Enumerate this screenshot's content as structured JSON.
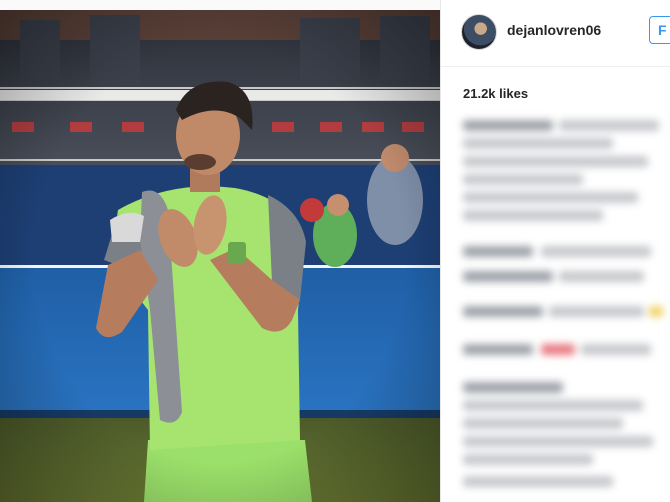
{
  "post": {
    "username": "dejanlovren06",
    "follow_label": "F",
    "likes": "21.2k likes"
  },
  "colors": {
    "accent": "#3897f0",
    "jersey": "#9be06a",
    "stand_blue": "#2a6bb0"
  },
  "icons": {
    "avatar": "profile-avatar"
  }
}
